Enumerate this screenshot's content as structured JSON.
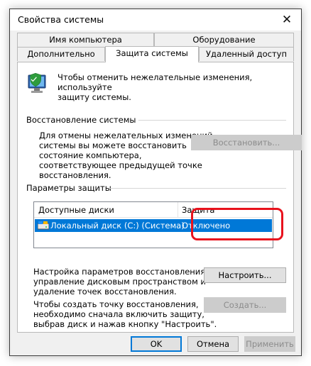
{
  "window": {
    "title": "Свойства системы",
    "close_glyph": "✕"
  },
  "tabs_row1": [
    {
      "label": "Имя компьютера"
    },
    {
      "label": "Оборудование"
    }
  ],
  "tabs_row2": [
    {
      "label": "Дополнительно"
    },
    {
      "label": "Защита системы",
      "active": true
    },
    {
      "label": "Удаленный доступ"
    }
  ],
  "intro": {
    "icon": "system-protection-icon",
    "text_lines": [
      "Чтобы отменить нежелательные изменения, используйте",
      "защиту системы."
    ]
  },
  "restore_group": {
    "title": "Восстановление системы",
    "text_lines": [
      "Для отмены нежелательных изменений",
      "системы вы можете восстановить",
      "состояние компьютера,",
      "соответствующее предыдущей точке",
      "восстановления."
    ],
    "restore_button": "Восстановить..."
  },
  "protection_group": {
    "title": "Параметры защиты",
    "columns": [
      "Доступные диски",
      "Защита"
    ],
    "rows": [
      {
        "drive": "Локальный диск (C:) (Система)",
        "status": "Отключено",
        "icon": "drive-icon",
        "selected": true
      }
    ],
    "configure_text_lines": [
      "Настройка параметров восстановления,",
      "управление дисковым пространством и",
      "удаление точек восстановления."
    ],
    "configure_button": "Настроить...",
    "create_text_lines": [
      "Чтобы создать точку восстановления,",
      "необходимо сначала включить защиту,",
      "выбрав диск и нажав кнопку \"Настроить\"."
    ],
    "create_button": "Создать..."
  },
  "footer": {
    "ok": "OK",
    "cancel": "Отмена",
    "apply": "Применить"
  },
  "colors": {
    "selection": "#0078d7",
    "highlight": "#e8121d"
  }
}
